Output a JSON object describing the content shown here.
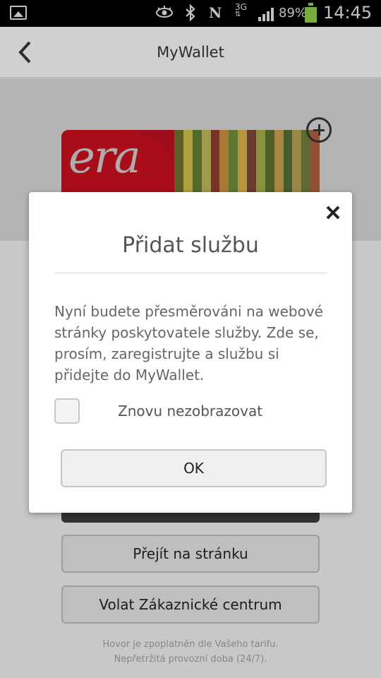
{
  "status_bar": {
    "network_type": "3G",
    "battery_percent": "89%",
    "time": "14:45",
    "icons": [
      "gallery-icon",
      "eye-icon",
      "bluetooth-icon",
      "nfc-icon",
      "network-3g-icon",
      "signal-icon",
      "battery-icon"
    ]
  },
  "appbar": {
    "title": "MyWallet",
    "back_icon": "chevron-left-icon"
  },
  "card": {
    "logo_text": "era",
    "add_icon": "plus-circle-icon",
    "stripe_colors": [
      "#6a6f2c",
      "#c9b84a",
      "#5e7b36",
      "#b8b155",
      "#8a3b30",
      "#c58d3a",
      "#6e8a3a",
      "#d2ae48",
      "#7a4436",
      "#9fa845",
      "#5f6d2e",
      "#c69a48",
      "#4f6a35",
      "#b09c52",
      "#6c7a38",
      "#a85c3c"
    ]
  },
  "actions": {
    "goto_page": "Přejít na stránku",
    "call_center": "Volat Zákaznické centrum"
  },
  "footnote": {
    "line1": "Hovor je zpoplatněn dle Vašeho tarifu.",
    "line2": "Nepřetržitá provozní doba (24/7)."
  },
  "dialog": {
    "title": "Přidat službu",
    "body": "Nyní budete přesměrováni na webové stránky poskytovatele služby. Zde se, prosím, zaregistrujte a službu si přidejte do MyWallet.",
    "checkbox_label": "Znovu nezobrazovat",
    "checkbox_checked": false,
    "ok_label": "OK",
    "close_icon": "close-icon"
  },
  "colors": {
    "accent_red": "#c3101e",
    "battery": "#8ac841"
  }
}
